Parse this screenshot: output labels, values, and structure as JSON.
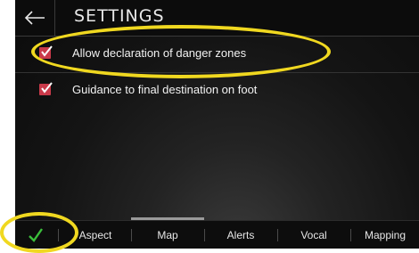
{
  "header": {
    "title": "SETTINGS",
    "back_icon": "back-arrow-icon"
  },
  "settings": [
    {
      "label": "Allow declaration of danger zones",
      "checked": true
    },
    {
      "label": "Guidance to final destination on foot",
      "checked": true
    }
  ],
  "bottom_bar": {
    "confirm_icon": "checkmark-icon",
    "tabs": [
      {
        "label": "Aspect"
      },
      {
        "label": "Map"
      },
      {
        "label": "Alerts"
      },
      {
        "label": "Vocal"
      },
      {
        "label": "Mapping"
      }
    ],
    "active_tab": "Map"
  },
  "colors": {
    "checkbox": "#c93a4a",
    "confirm": "#3bbf3b",
    "highlight": "#f0d820",
    "text": "#f2f2f2"
  }
}
